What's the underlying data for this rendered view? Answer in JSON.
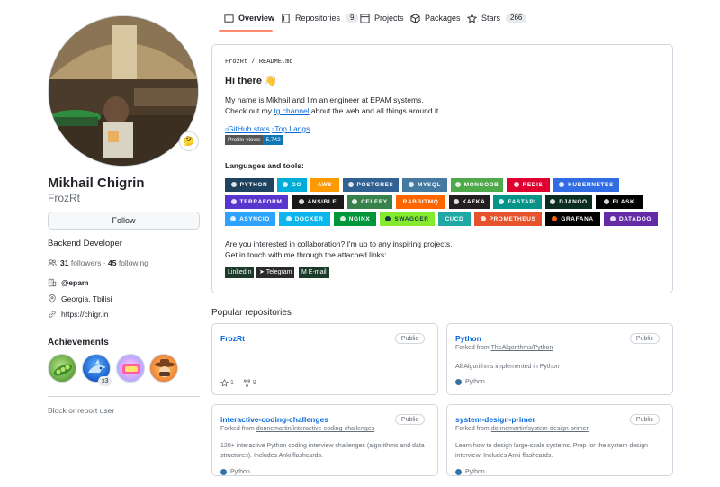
{
  "nav": {
    "overview": "Overview",
    "repositories": "Repositories",
    "repositories_count": "9",
    "projects": "Projects",
    "packages": "Packages",
    "stars": "Stars",
    "stars_count": "266"
  },
  "profile": {
    "status_emoji": "🤔",
    "name": "Mikhail Chigrin",
    "login": "FrozRt",
    "follow_label": "Follow",
    "bio": "Backend Developer",
    "followers_count": "31",
    "followers_label": "followers",
    "separator": "·",
    "following_count": "45",
    "following_label": "following",
    "company": "@epam",
    "location": "Georgia, Tbilisi",
    "website": "https://chigr.in",
    "achievements_title": "Achievements",
    "achievement_multiplier": "x3",
    "block_label": "Block or report user"
  },
  "readme": {
    "path_owner": "FrozRt",
    "path_sep": "/",
    "path_file": "README.md",
    "greeting": "Hi there 👋",
    "intro_line": "My name is Mikhail and I'm an engineer at EPAM systems.",
    "channel_before": "Check out my ",
    "channel_link": "tg channel",
    "channel_after": " about the web and all things around it.",
    "img_stats": "GitHub stats",
    "img_langs": "Top Langs",
    "views_label": "Profile views",
    "views_count": "5,742",
    "tools_title": "Languages and tools:",
    "tools": [
      {
        "label": "PYTHON",
        "color": "#1f425f"
      },
      {
        "label": "GO",
        "color": "#00add8"
      },
      {
        "label": "AWS",
        "color": "#ff9900"
      },
      {
        "label": "POSTGRES",
        "color": "#316192"
      },
      {
        "label": "MYSQL",
        "color": "#4479a1"
      },
      {
        "label": "MONGODB",
        "color": "#4ea94b"
      },
      {
        "label": "REDIS",
        "color": "#dd0031"
      },
      {
        "label": "KUBERNETES",
        "color": "#326ce5"
      },
      {
        "label": "TERRAFORM",
        "color": "#5835cc"
      },
      {
        "label": "ANSIBLE",
        "color": "#1a1918"
      },
      {
        "label": "CELERY",
        "color": "#37814a"
      },
      {
        "label": "RABBITMQ",
        "color": "#ff6600"
      },
      {
        "label": "KAFKA",
        "color": "#231f20"
      },
      {
        "label": "FASTAPI",
        "color": "#059487"
      },
      {
        "label": "DJANGO",
        "color": "#092e20"
      },
      {
        "label": "FLASK",
        "color": "#000000"
      },
      {
        "label": "ASYNCIO",
        "color": "#2ea2ff"
      },
      {
        "label": "DOCKER",
        "color": "#0db7ed"
      },
      {
        "label": "NGINX",
        "color": "#009639"
      },
      {
        "label": "SWAGGER",
        "color": "#85ea2d"
      },
      {
        "label": "CI/CD",
        "color": "#20a9a4"
      },
      {
        "label": "PROMETHEUS",
        "color": "#e6522c"
      },
      {
        "label": "GRAFANA",
        "color": "#000000"
      },
      {
        "label": "DATADOG",
        "color": "#632ca6"
      }
    ],
    "collab_line1": "Are you interested in collaboration? I'm up to any inspiring projects.",
    "collab_line2": "Get in touch with me through the attached links:",
    "social": [
      "LinkedIn",
      "Telegram",
      "E-mail"
    ]
  },
  "popular": {
    "title": "Popular repositories",
    "repos": [
      {
        "name": "FrozRt",
        "visibility": "Public",
        "stars": "1",
        "forks": "9"
      },
      {
        "name": "Python",
        "visibility": "Public",
        "fork_prefix": "Forked from ",
        "fork_source": "TheAlgorithms/Python",
        "description": "All Algorithms implemented in Python",
        "language": "Python"
      },
      {
        "name": "interactive-coding-challenges",
        "visibility": "Public",
        "fork_prefix": "Forked from ",
        "fork_source": "donnemartin/interactive-coding-challenges",
        "description_line1": "120+ interactive Python coding interview challenges (algorithms and data",
        "description_line2": "structures). Includes Anki flashcards.",
        "language": "Python"
      },
      {
        "name": "system-design-primer",
        "visibility": "Public",
        "fork_prefix": "Forked from ",
        "fork_source": "donnemartin/system-design-primer",
        "description_line1": "Learn how to design large-scale systems. Prep for the system design",
        "description_line2": "interview. Includes Anki flashcards.",
        "language": "Python"
      }
    ]
  },
  "colors": {
    "accent_link": "#0969da",
    "nav_underline": "#fd8c73",
    "border": "#d0d7de",
    "python_lang": "#3572a5"
  }
}
